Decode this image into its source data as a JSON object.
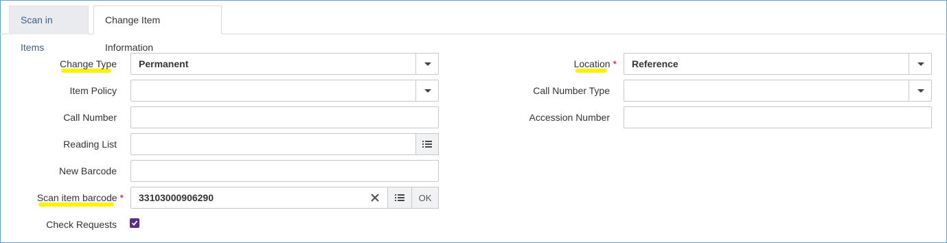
{
  "tabs": [
    {
      "label": "Scan in Items"
    },
    {
      "label": "Change Item Information"
    }
  ],
  "left_fields": {
    "change_type": {
      "label": "Change Type",
      "value": "Permanent"
    },
    "item_policy": {
      "label": "Item Policy",
      "value": ""
    },
    "call_number": {
      "label": "Call Number",
      "value": ""
    },
    "reading_list": {
      "label": "Reading List",
      "value": ""
    },
    "new_barcode": {
      "label": "New Barcode",
      "value": ""
    },
    "scan_item_barcode": {
      "label": "Scan item barcode",
      "required_mark": "*",
      "value": "33103000906290",
      "ok_label": "OK"
    },
    "check_requests": {
      "label": "Check Requests",
      "checked": true
    }
  },
  "right_fields": {
    "location": {
      "label": "Location",
      "required_mark": "*",
      "value": "Reference"
    },
    "call_number_type": {
      "label": "Call Number Type",
      "value": ""
    },
    "accession_number": {
      "label": "Accession Number",
      "value": ""
    }
  },
  "icons": {
    "dropdown": "caret-down-icon",
    "list": "list-icon",
    "clear": "clear-x-icon",
    "checkmark": "checkmark-icon"
  },
  "colors": {
    "highlight": "#fff200",
    "required": "#d0021b",
    "checkbox": "#5b2c8a",
    "tab_inactive_text": "#3e5c8a"
  }
}
